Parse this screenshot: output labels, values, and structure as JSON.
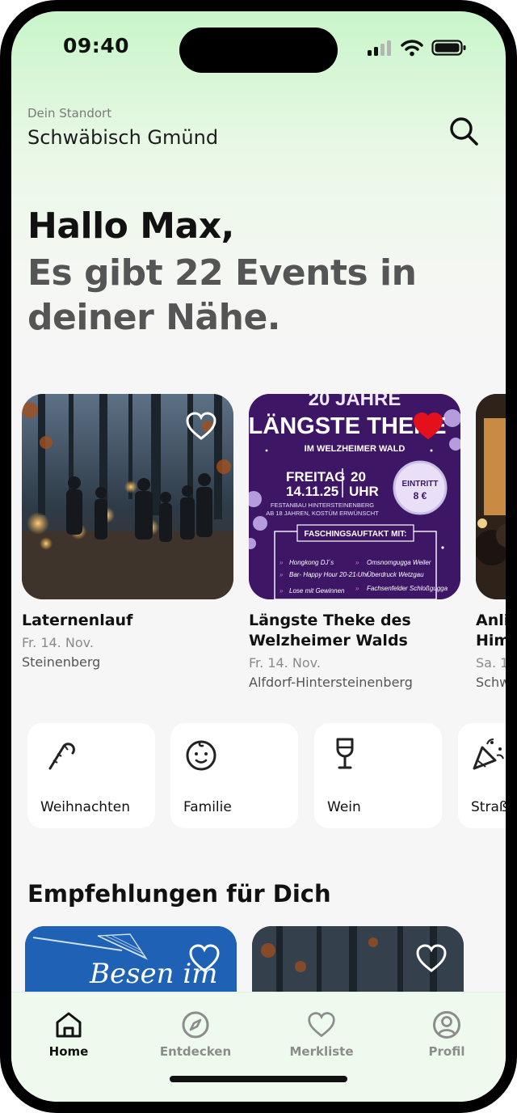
{
  "status": {
    "time": "09:40"
  },
  "location": {
    "label": "Dein Standort",
    "name": "Schwäbisch Gmünd"
  },
  "greeting": {
    "line1": "Hallo Max,",
    "line2": "Es gibt 22 Events in deiner Nähe."
  },
  "events": [
    {
      "title": "Laternenlauf",
      "date": "Fr. 14. Nov.",
      "place": "Steinenberg",
      "favorite": false
    },
    {
      "title": "Längste Theke des Welzheimer Walds",
      "date": "Fr. 14. Nov.",
      "place": "Alfdorf-Hintersteinenberg",
      "favorite": true,
      "poster": {
        "headline_top": "20 JAHRE",
        "headline": "LÄNGSTE THEKE",
        "subline": "IM WELZHEIMER WALD",
        "day": "FREITAG",
        "date": "14.11.25",
        "hour": "20",
        "hour_unit": "UHR",
        "entry_label": "EINTRITT",
        "entry_price": "8 €",
        "venue": "FESTANBAU HINTERSTEINENBERG",
        "note": "AB 18 JAHREN, KOSTÜM ERWÜNSCHT",
        "section": "FASCHINGSAUFTAKT MIT:",
        "items": [
          "Hongkong DJ´s",
          "Omsnomgugga Weiler",
          "Bar- Happy Hour 20-21 Uhr",
          "Überdruck Wetzgau",
          "Lose mit Gewinnen",
          "Fachsenfelder Schloßgugga"
        ]
      }
    },
    {
      "title": "Anli Him",
      "date": "Sa. 1",
      "place": "Schw",
      "favorite": false
    }
  ],
  "categories": [
    {
      "label": "Weihnachten",
      "icon": "candy-cane-icon"
    },
    {
      "label": "Familie",
      "icon": "baby-face-icon"
    },
    {
      "label": "Wein",
      "icon": "wine-glass-icon"
    },
    {
      "label": "Straß",
      "icon": "party-popper-icon"
    }
  ],
  "recommendations": {
    "title": "Empfehlungen für Dich",
    "items": [
      {
        "poster_text": "Besen im"
      },
      {
        "poster_text": ""
      }
    ]
  },
  "tabbar": {
    "items": [
      {
        "label": "Home",
        "icon": "home-icon",
        "active": true
      },
      {
        "label": "Entdecken",
        "icon": "compass-icon",
        "active": false
      },
      {
        "label": "Merkliste",
        "icon": "heart-icon",
        "active": false
      },
      {
        "label": "Profil",
        "icon": "profile-icon",
        "active": false
      }
    ]
  },
  "colors": {
    "accent_green": "#c8f5c9",
    "favorite_red": "#e4101c",
    "poster_purple": "#3b1563",
    "poster_blue": "#1d5fb0"
  }
}
